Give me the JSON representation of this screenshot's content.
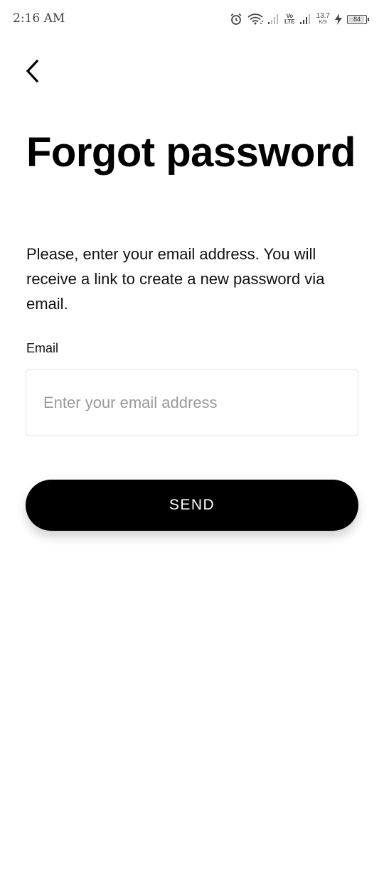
{
  "status_bar": {
    "time": "2:16 AM",
    "network_top": "Vo",
    "network_bottom": "LTE",
    "speed_value": "13.7",
    "speed_unit": "K/S",
    "battery": "84",
    "icons": [
      "alarm-icon",
      "wifi-icon",
      "signal-icon",
      "signal-icon",
      "charging-icon",
      "battery-icon"
    ]
  },
  "header": {
    "back_icon": "chevron-left-icon"
  },
  "main": {
    "title": "Forgot password",
    "description": "Please, enter your email address. You will receive a link to create a new password via email.",
    "email_label": "Email",
    "email_placeholder": "Enter your email address",
    "email_value": "",
    "send_label": "SEND"
  },
  "colors": {
    "background": "#ffffff",
    "primary": "#000000",
    "button_text": "#ffffff",
    "placeholder": "#9a9a9a",
    "input_border": "#e2e2e2"
  }
}
